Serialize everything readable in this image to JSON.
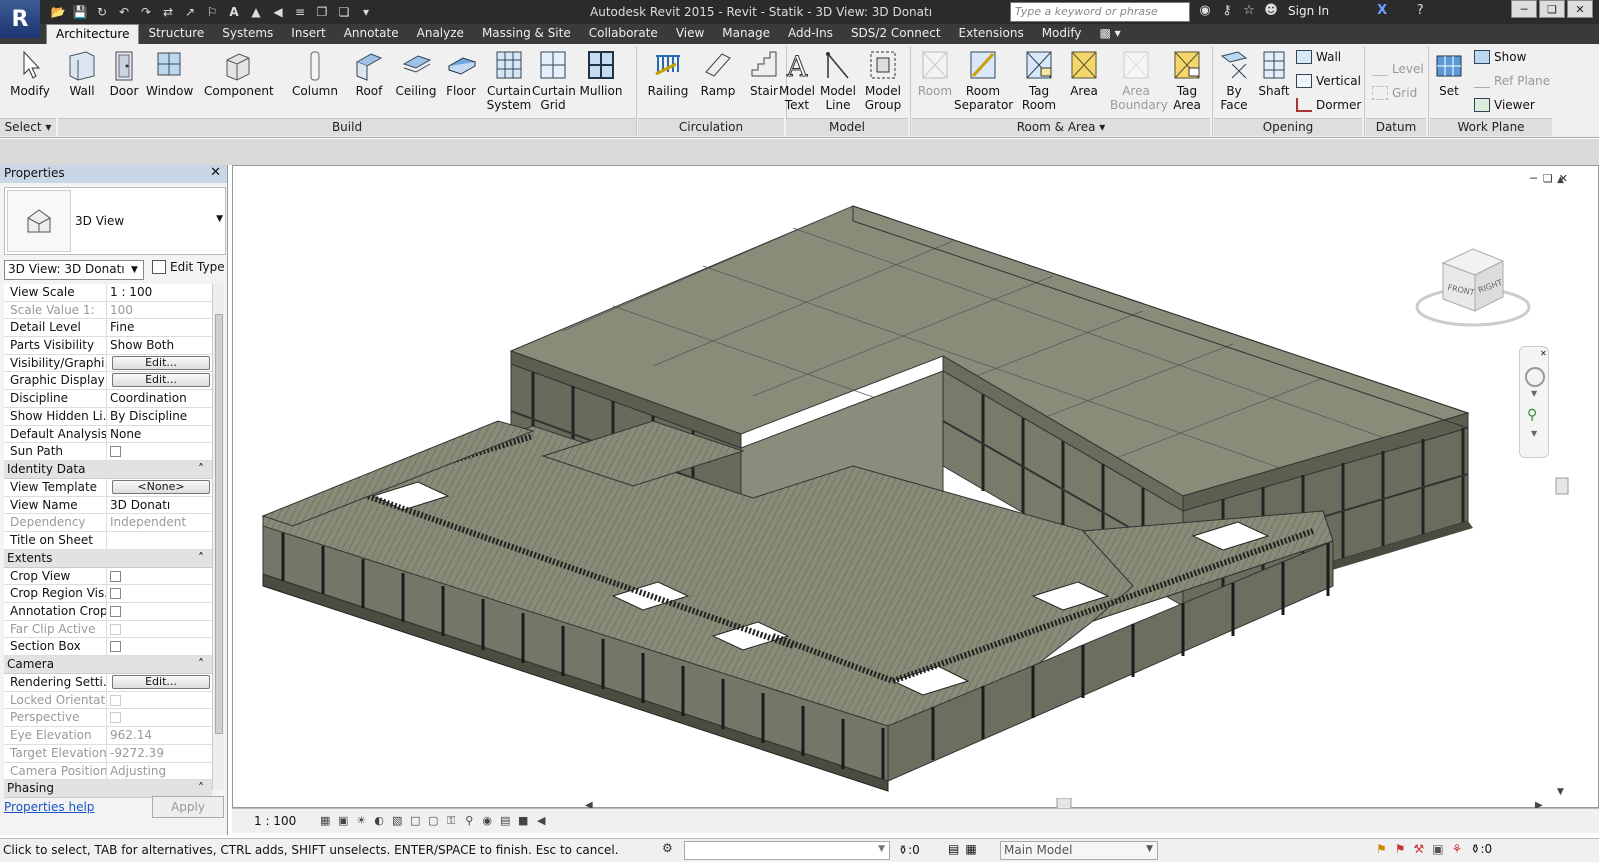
{
  "app": {
    "logo": "R",
    "title": "Autodesk Revit 2015 -    Revit - Statik - 3D View: 3D Donatı"
  },
  "search": {
    "placeholder": "Type a keyword or phrase"
  },
  "user": {
    "sign_in": "Sign In"
  },
  "tabs": [
    "Architecture",
    "Structure",
    "Systems",
    "Insert",
    "Annotate",
    "Analyze",
    "Massing & Site",
    "Collaborate",
    "View",
    "Manage",
    "Add-Ins",
    "SDS/2 Connect",
    "Extensions",
    "Modify"
  ],
  "ribbon": {
    "tools": {
      "modify": "Modify",
      "wall": "Wall",
      "door": "Door",
      "window": "Window",
      "component": "Component",
      "column": "Column",
      "roof": "Roof",
      "ceiling": "Ceiling",
      "floor": "Floor",
      "curtain_system": "Curtain System",
      "curtain_grid": "Curtain Grid",
      "mullion": "Mullion",
      "railing": "Railing",
      "ramp": "Ramp",
      "stair": "Stair",
      "model_text": "Model Text",
      "model_line": "Model Line",
      "model_group": "Model Group",
      "room": "Room",
      "room_separator": "Room Separator",
      "tag_room": "Tag Room",
      "area": "Area",
      "area_boundary": "Area Boundary",
      "tag_area": "Tag Area",
      "by_face": "By Face",
      "shaft": "Shaft",
      "wall_opening": "Wall",
      "vertical": "Vertical",
      "dormer": "Dormer",
      "level": "Level",
      "grid": "Grid",
      "set": "Set",
      "show": "Show",
      "ref_plane": "Ref  Plane",
      "viewer": "Viewer"
    },
    "panels": {
      "select": "Select",
      "build": "Build",
      "circulation": "Circulation",
      "model": "Model",
      "room_area": "Room & Area",
      "opening": "Opening",
      "datum": "Datum",
      "work_plane": "Work Plane"
    }
  },
  "properties": {
    "title": "Properties",
    "type_name": "3D View",
    "view_selector": "3D View: 3D Donatı",
    "edit_type": "Edit Type",
    "graphics": [
      {
        "name": "View Scale",
        "value": "1 : 100",
        "kind": "text"
      },
      {
        "name": "Scale Value    1:",
        "value": "100",
        "kind": "gray"
      },
      {
        "name": "Detail Level",
        "value": "Fine",
        "kind": "text"
      },
      {
        "name": "Parts Visibility",
        "value": "Show Both",
        "kind": "text"
      },
      {
        "name": "Visibility/Graphi...",
        "value": "Edit...",
        "kind": "button"
      },
      {
        "name": "Graphic Display ...",
        "value": "Edit...",
        "kind": "button"
      },
      {
        "name": "Discipline",
        "value": "Coordination",
        "kind": "text"
      },
      {
        "name": "Show Hidden Li...",
        "value": "By Discipline",
        "kind": "text"
      },
      {
        "name": "Default Analysis...",
        "value": "None",
        "kind": "text"
      },
      {
        "name": "Sun Path",
        "value": "",
        "kind": "check"
      }
    ],
    "identity_title": "Identity Data",
    "identity": [
      {
        "name": "View Template",
        "value": "<None>",
        "kind": "button"
      },
      {
        "name": "View Name",
        "value": "3D Donatı",
        "kind": "text"
      },
      {
        "name": "Dependency",
        "value": "Independent",
        "kind": "gray"
      },
      {
        "name": "Title on Sheet",
        "value": "",
        "kind": "text"
      }
    ],
    "extents_title": "Extents",
    "extents": [
      {
        "name": "Crop View",
        "value": "",
        "kind": "check"
      },
      {
        "name": "Crop Region Vis...",
        "value": "",
        "kind": "check"
      },
      {
        "name": "Annotation Crop",
        "value": "",
        "kind": "check"
      },
      {
        "name": "Far Clip Active",
        "value": "",
        "kind": "graycheck"
      },
      {
        "name": "Section Box",
        "value": "",
        "kind": "check"
      }
    ],
    "camera_title": "Camera",
    "camera": [
      {
        "name": "Rendering Setti...",
        "value": "Edit...",
        "kind": "button"
      },
      {
        "name": "Locked Orientat...",
        "value": "",
        "kind": "graycheck"
      },
      {
        "name": "Perspective",
        "value": "",
        "kind": "graycheck"
      },
      {
        "name": "Eye Elevation",
        "value": "962.14",
        "kind": "gray"
      },
      {
        "name": "Target Elevation",
        "value": "-9272.39",
        "kind": "gray"
      },
      {
        "name": "Camera Position",
        "value": "Adjusting",
        "kind": "gray"
      }
    ],
    "phasing_title": "Phasing",
    "help": "Properties help",
    "apply": "Apply"
  },
  "viewcube": {
    "front": "FRONT",
    "right": "RIGHT"
  },
  "view_bar": {
    "scale": "1 : 100"
  },
  "status": {
    "message": "Click to select, TAB for alternatives, CTRL adds, SHIFT unselects. ENTER/SPACE to finish. Esc to cancel.",
    "filter_count": ":0",
    "model": "Main Model",
    "selection_count": ":0"
  },
  "colors": {
    "ribbon_bg": "#f0f0f0",
    "titlebar": "#2b2b2b",
    "slab": "#7d7d6c",
    "slab_top": "#8a8a78",
    "link": "#1a55c8"
  }
}
